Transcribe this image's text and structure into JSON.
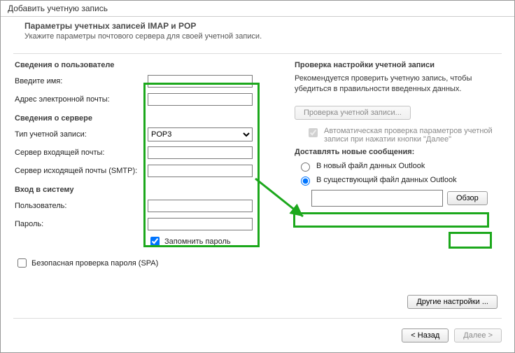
{
  "window_title": "Добавить учетную запись",
  "header": {
    "title": "Параметры учетных записей IMAP и POP",
    "subtitle": "Укажите параметры почтового сервера для своей учетной записи."
  },
  "left": {
    "user_section": "Сведения о пользователе",
    "name_label": "Введите имя:",
    "email_label": "Адрес электронной почты:",
    "server_section": "Сведения о сервере",
    "account_type_label": "Тип учетной записи:",
    "account_type_value": "POP3",
    "incoming_label": "Сервер входящей почты:",
    "outgoing_label": "Сервер исходящей почты (SMTP):",
    "login_section": "Вход в систему",
    "user_label": "Пользователь:",
    "pass_label": "Пароль:",
    "remember_label": "Запомнить пароль",
    "spa_label": "Безопасная проверка пароля (SPA)"
  },
  "right": {
    "test_section": "Проверка настройки учетной записи",
    "test_text": "Рекомендуется проверить учетную запись, чтобы убедиться в правильности введенных данных.",
    "test_button": "Проверка учетной записи...",
    "auto_test_label": "Автоматическая проверка параметров учетной записи при нажатии кнопки \"Далее\"",
    "deliver_section": "Доставлять новые сообщения:",
    "radio_new": "В новый файл данных Outlook",
    "radio_existing": "В существующий файл данных Outlook",
    "browse_button": "Обзор",
    "more_button": "Другие настройки ..."
  },
  "footer": {
    "back": "< Назад",
    "next": "Далее >"
  }
}
